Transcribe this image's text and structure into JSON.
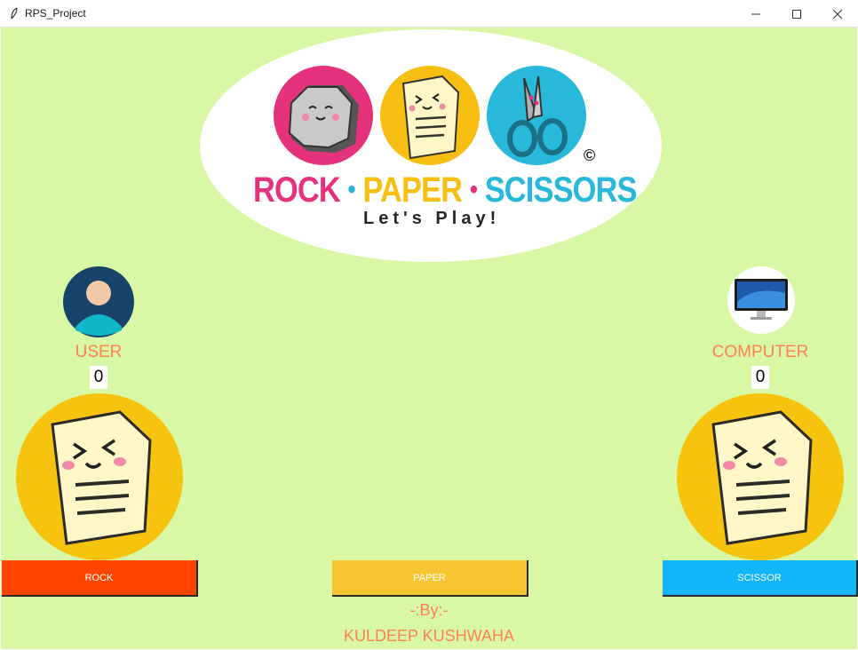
{
  "window": {
    "title": "RPS_Project",
    "app_icon": "feather-icon",
    "controls": [
      "minimize-icon",
      "maximize-icon",
      "close-icon"
    ]
  },
  "logo": {
    "word_rock": "ROCK",
    "word_paper": "PAPER",
    "word_scissors": "SCISSORS",
    "separator": "•",
    "copyright": "©",
    "tagline": "Let's Play!",
    "icons": [
      "rock-icon",
      "paper-icon",
      "scissors-icon"
    ]
  },
  "user": {
    "label": "USER",
    "score": "0",
    "avatar_icon": "user-avatar-icon",
    "choice_icon": "paper-icon"
  },
  "computer": {
    "label": "COMPUTER",
    "score": "0",
    "avatar_icon": "computer-monitor-icon",
    "choice_icon": "paper-icon"
  },
  "buttons": {
    "rock": "ROCK",
    "paper": "PAPER",
    "scissor": "SCISSOR"
  },
  "credits": {
    "by": "-:By:-",
    "name": "KULDEEP KUSHWAHA"
  },
  "colors": {
    "background": "#d9f8a6",
    "rock": "#ff4500",
    "paper": "#f9c633",
    "scissor": "#12b5f8",
    "label": "#ff7f50",
    "logo_pink": "#e5327c",
    "logo_yellow": "#f6bf11",
    "logo_cyan": "#27b8da"
  }
}
